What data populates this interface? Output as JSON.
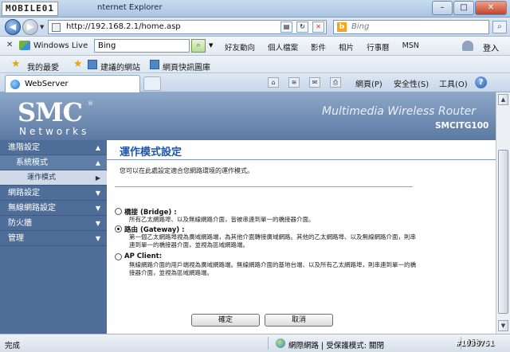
{
  "titlebar": {
    "watermark": "MOBILE01",
    "title": "nternet Explorer"
  },
  "address": {
    "url": "http://192.168.2.1/home.asp",
    "search_engine": "Bing"
  },
  "live_toolbar": {
    "brand": "Windows Live",
    "search_value": "Bing",
    "links": [
      "好友動向",
      "個人檔案",
      "影件",
      "相片",
      "行事曆",
      "MSN"
    ],
    "login": "登入"
  },
  "favorites": {
    "label": "我的最愛",
    "suggested": "建議的網站",
    "gallery": "網頁快訊圖庫"
  },
  "tabbar": {
    "tab_label": "WebServer",
    "commands": {
      "page": "網頁(P)",
      "safety": "安全性(S)",
      "tools": "工具(O)"
    }
  },
  "router": {
    "brand": "SMC",
    "registered": "®",
    "networks": "Networks",
    "product": "Multimedia Wireless Router",
    "model": "SMCITG100"
  },
  "sidebar": {
    "items": [
      {
        "label": "進階設定",
        "level": "top"
      },
      {
        "label": "系統模式",
        "level": "sub"
      },
      {
        "label": "運作模式",
        "level": "selected"
      },
      {
        "label": "網路設定",
        "level": "top"
      },
      {
        "label": "無線網路設定",
        "level": "top"
      },
      {
        "label": "防火牆",
        "level": "top"
      },
      {
        "label": "管理",
        "level": "top"
      }
    ]
  },
  "main": {
    "title": "運作模式設定",
    "description": "您可以在此處設定適合您網路環境的運作模式。",
    "options": [
      {
        "title": "橋接 (Bridge) :",
        "body": "所有乙太網路埠、以及無線網路介面，皆被串連到單一的橋接器介面。",
        "selected": false
      },
      {
        "title": "路由 (Gateway) :",
        "body": "第一個乙太網路埠視為廣域網路端，為其他介面轉接廣域網路。其他的乙太網路埠、以及無線網路介面，則串連到單一的橋接器介面，並視為區域網路端。",
        "selected": true
      },
      {
        "title": "AP Client:",
        "body": "無線網路介面的用戶端視為廣域網路端。無線網路介面的基地台端、以及所有乙太網路埠，則串連到單一的橋接器介面，並視為區域網路端。",
        "selected": false
      }
    ],
    "ok_label": "確定",
    "cancel_label": "取消"
  },
  "status": {
    "left": "完成",
    "zone": "網際網路 | 受保護模式: 關閉",
    "zoom": "95%",
    "watermark": "#1036751"
  }
}
